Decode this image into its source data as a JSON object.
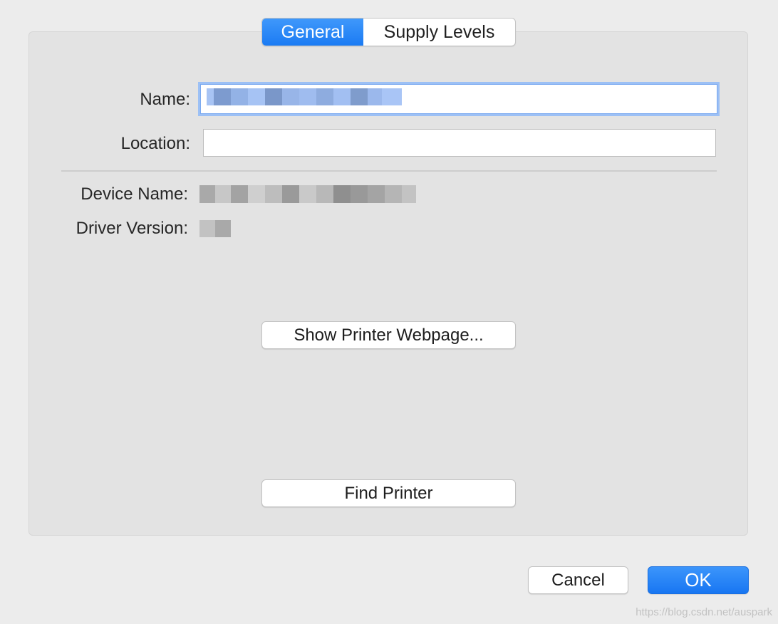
{
  "tabs": {
    "general": "General",
    "supply_levels": "Supply Levels"
  },
  "form": {
    "name_label": "Name:",
    "location_label": "Location:",
    "device_name_label": "Device Name:",
    "driver_version_label": "Driver Version:"
  },
  "buttons": {
    "show_webpage": "Show Printer Webpage...",
    "find_printer": "Find Printer",
    "cancel": "Cancel",
    "ok": "OK"
  },
  "colors": {
    "accent": "#1b7bf3",
    "focus_ring": "#9cc0f5",
    "window_bg": "#ececec",
    "panel_bg": "#e3e3e3"
  },
  "watermark": "https://blog.csdn.net/auspark"
}
